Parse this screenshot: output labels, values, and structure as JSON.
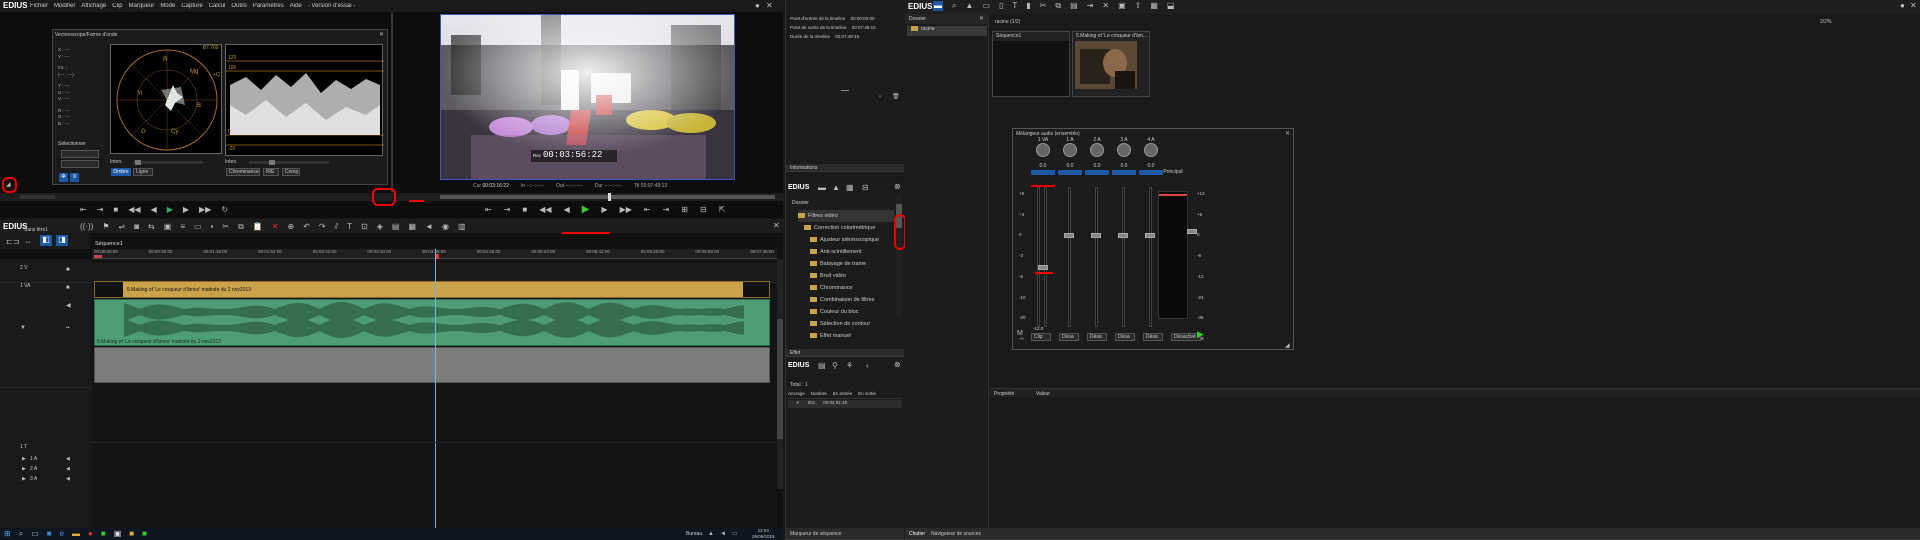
{
  "app": {
    "logo": "EDIUS",
    "menus": [
      "Fichier",
      "Modifier",
      "Affichage",
      "Clip",
      "Marqueur",
      "Mode",
      "Capture",
      "Calcul",
      "Outils",
      "Paramètres",
      "Aide",
      "- Version d'essai -"
    ]
  },
  "scope": {
    "title": "Vectoroscope/Forme d'onde",
    "labels_left": [
      "X : ---",
      "Y : ---",
      "Z : ---",
      "Int. :",
      "Y : ---",
      "U : ---",
      "V : ---",
      "R : ---",
      "G : ---",
      "B : ---"
    ],
    "inner_coords": "(--- , ---)",
    "wave_labels": {
      "bt": "BT.709",
      "top1": "120",
      "top2": "100",
      "q": "+Q",
      "zero": "0",
      "m20": "-20"
    },
    "select_label": "Sélectionner",
    "inten_label": "Inten.",
    "btn_ombre": "Ombre",
    "btn_ligne": "Ligne",
    "btn_chrom": "Chrominance",
    "btn_ire": "IRE",
    "btn_comp": "Comp"
  },
  "player": {
    "timecode": "00:03:56:22",
    "timecode_prefix": "Rec",
    "cur_label": "Cur",
    "cur_value": "00:03:16:22",
    "in_label": "In",
    "in_value": "--:--:--:--",
    "out_label": "Out",
    "out_value": "--:--:--:--",
    "dur_label": "Dur",
    "dur_value": "--:--:--:--",
    "ttl_label": "Ttl",
    "ttl_value": "00:07:49:13"
  },
  "info": {
    "rows": [
      {
        "label": "Point d'entrée de la timeline",
        "value": "00:00:00:00"
      },
      {
        "label": "Point de sortie de la timeline",
        "value": "00:07:49:15"
      },
      {
        "label": "Durée de la timeline",
        "value": "00:07:49:15"
      }
    ],
    "tab": "Informations"
  },
  "timeline": {
    "logo": "EDIUS",
    "project": "Sans titre1",
    "sequence": "Séquence1",
    "ruler": [
      "00:00:00:00",
      "00:00:38:00",
      "00:01:16:00",
      "00:01:54:00",
      "00:02:32:00",
      "00:03:10:00",
      "00:03:48:00",
      "00:04:26:00",
      "00:05:04:00",
      "00:05:42:00",
      "00:06:20:00",
      "00:06:58:00",
      "00:07:36:00"
    ],
    "track_2v": "2 V",
    "track_1va": "1 VA",
    "track_1t": "1 T",
    "track_1a": "1 A",
    "track_2a": "2 A",
    "track_3a": "3 A",
    "clip_video_title": "5.Making of 'Le croqueur d'âmes' matinée du 2 nov2013",
    "clip_audio_title": "5.Making of 'Le croqueur d'âmes' matinée du 2 nov2013",
    "track_small": "Ma"
  },
  "effects": {
    "logo": "EDIUS",
    "root": "Dossier",
    "items": [
      "Filtres vidéo",
      "Correction colorimétrique",
      "Ajusteur stéréoscopique",
      "Anti-scintillement",
      "Balayage de trame",
      "Bruit vidéo",
      "Chrominance",
      "Combinaison de filtres",
      "Couleur du bloc",
      "Sélection de contour",
      "Effet manuel"
    ],
    "tab": "Effet"
  },
  "markers": {
    "logo": "EDIUS",
    "total": "Total : 1",
    "columns": [
      "Ancrage",
      "Nombre",
      "En entrée",
      "En sortie"
    ],
    "row": {
      "num": "001",
      "in": "00:04:01:10"
    },
    "tab": "Marqueur de séquence"
  },
  "bin": {
    "logo": "EDIUS",
    "folder_header": "Dossier",
    "root_item": "racine",
    "path": "racine (1/2)",
    "zoom": "2/2%",
    "clip1": "Séquence1",
    "clip2": "5.Making of 'Le croqueur d'âm...",
    "prop_col1": "Propriété",
    "prop_col2": "Valeur",
    "tab1": "Chutier",
    "tab2": "Navigateur de sources"
  },
  "mixer": {
    "title": "Mélangeur audio (ensemble)",
    "channels": [
      "1 VA",
      "1 A",
      "2 A",
      "3 A",
      "4 A"
    ],
    "master": "Principal",
    "peak": "0.0",
    "bottom_left": "-12.0",
    "bottom_vals": [
      "0.0",
      "0.0",
      "0.0",
      "0.0"
    ],
    "modes": [
      "Clip",
      "Désa",
      "Désa",
      "Désa",
      "Désa"
    ],
    "master_mode": "Désactivé",
    "scale_left": [
      "+6",
      "+3",
      "0",
      "-3",
      "-6",
      "-10",
      "-20",
      "-∞"
    ],
    "scale_right": [
      "+12",
      "+6",
      "0",
      "-6",
      "-12",
      "-24",
      "-36",
      "-48"
    ]
  },
  "taskbar": {
    "locale": "Bureau",
    "time": "12:04",
    "date": "26/06/2015"
  }
}
